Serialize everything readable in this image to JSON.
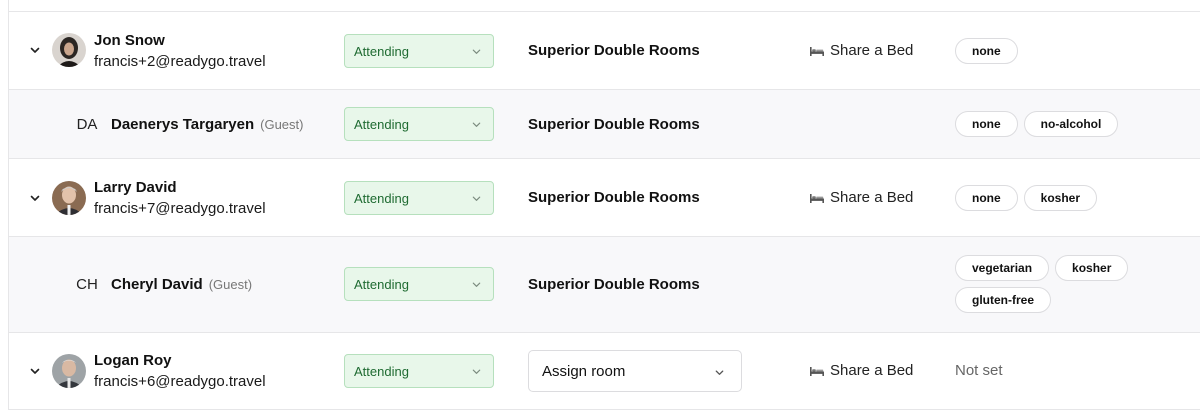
{
  "rows": [
    {
      "type": "host",
      "name": "Jon Snow",
      "email": "francis+2@readygo.travel",
      "status": "Attending",
      "room": "Superior Double Rooms",
      "bed": "Share a Bed",
      "tags": [
        "none"
      ]
    },
    {
      "type": "guest",
      "initials": "DA",
      "name": "Daenerys Targaryen",
      "guest_label": "(Guest)",
      "status": "Attending",
      "room": "Superior Double Rooms",
      "tags": [
        "none",
        "no-alcohol"
      ]
    },
    {
      "type": "host",
      "name": "Larry David",
      "email": "francis+7@readygo.travel",
      "status": "Attending",
      "room": "Superior Double Rooms",
      "bed": "Share a Bed",
      "tags": [
        "none",
        "kosher"
      ]
    },
    {
      "type": "guest",
      "initials": "CH",
      "name": "Cheryl David",
      "guest_label": "(Guest)",
      "status": "Attending",
      "room": "Superior Double Rooms",
      "tags": [
        "vegetarian",
        "kosher",
        "gluten-free"
      ]
    },
    {
      "type": "host",
      "name": "Logan Roy",
      "email": "francis+6@readygo.travel",
      "status": "Attending",
      "room_select_placeholder": "Assign room",
      "bed": "Share a Bed",
      "tags_empty": "Not set"
    }
  ],
  "icons": {
    "expand": "chevron-down-icon",
    "status_caret": "chevron-down-icon",
    "bed": "bed-icon"
  },
  "colors": {
    "status_bg": "#e8f7ea",
    "status_border": "#b6e0bd",
    "status_text": "#1f6b32",
    "row_border": "#e6e6e8",
    "guest_row_bg": "#f8f8fa"
  }
}
